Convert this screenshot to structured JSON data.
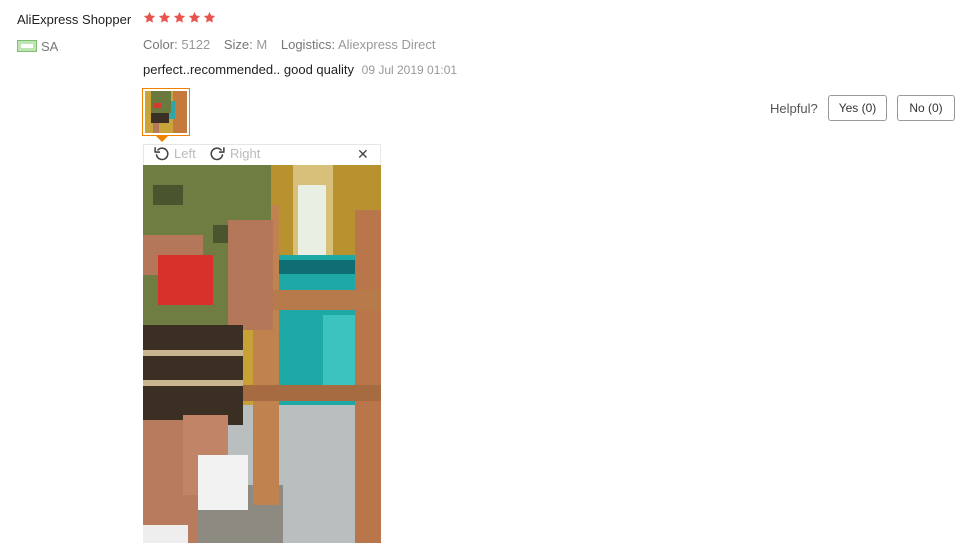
{
  "review": {
    "user_name": "AliExpress Shopper",
    "rating": 5,
    "rating_max": 5,
    "country": "SA",
    "color_label": "Color:",
    "color_value": "5122",
    "size_label": "Size:",
    "size_value": "M",
    "logistics_label": "Logistics:",
    "logistics_value": "Aliexpress Direct",
    "text": "perfect..recommended.. good quality",
    "date": "09 Jul 2019 01:01"
  },
  "helpful": {
    "label": "Helpful?",
    "yes_label": "Yes (0)",
    "no_label": "No (0)"
  },
  "viewer": {
    "rotate_left_label": "Left",
    "rotate_right_label": "Right",
    "close_symbol": "✕"
  },
  "colors": {
    "star": "#e8554e",
    "accent_border": "#f08200"
  },
  "icons": [
    "star-icon",
    "flag-icon",
    "rotate-left-icon",
    "rotate-right-icon",
    "close-icon"
  ]
}
